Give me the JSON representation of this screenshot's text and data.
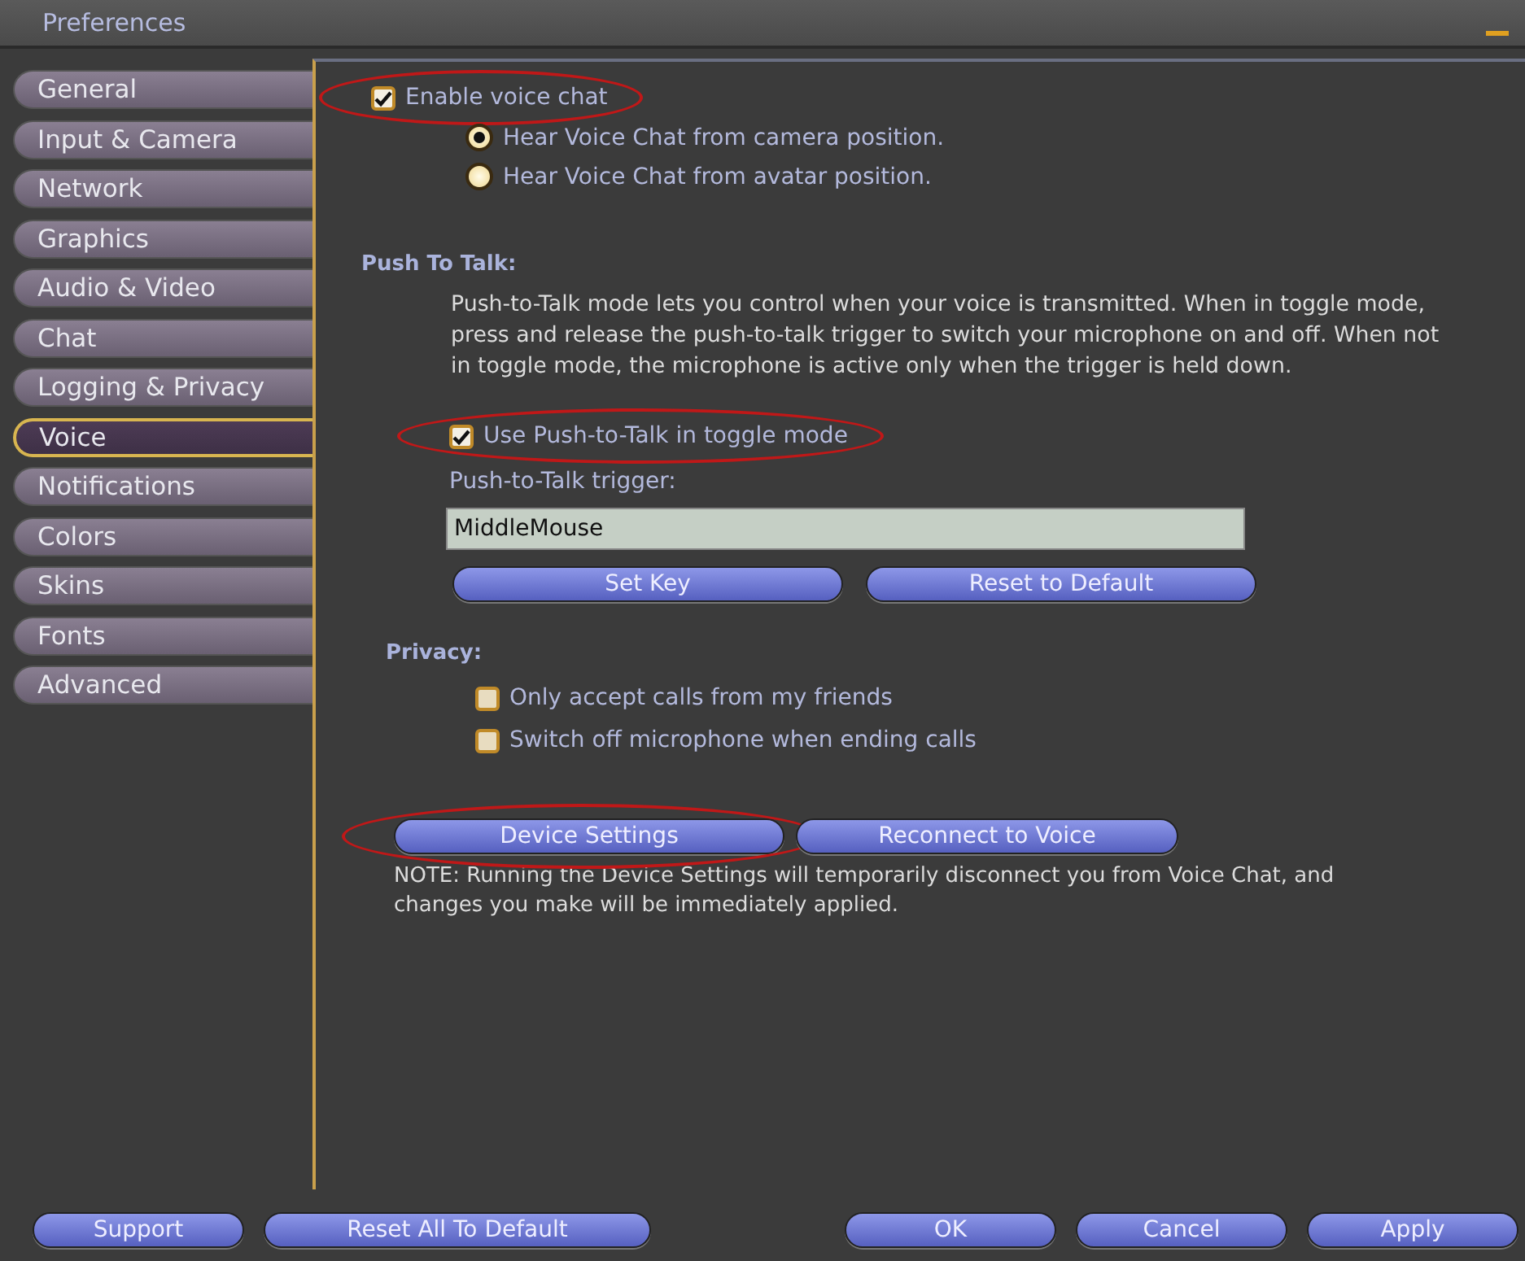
{
  "window": {
    "title": "Preferences"
  },
  "sidebar": {
    "items": [
      {
        "label": "General",
        "selected": false
      },
      {
        "label": "Input & Camera",
        "selected": false
      },
      {
        "label": "Network",
        "selected": false
      },
      {
        "label": "Graphics",
        "selected": false
      },
      {
        "label": "Audio & Video",
        "selected": false
      },
      {
        "label": "Chat",
        "selected": false
      },
      {
        "label": "Logging & Privacy",
        "selected": false
      },
      {
        "label": "Voice",
        "selected": true
      },
      {
        "label": "Notifications",
        "selected": false
      },
      {
        "label": "Colors",
        "selected": false
      },
      {
        "label": "Skins",
        "selected": false
      },
      {
        "label": "Fonts",
        "selected": false
      },
      {
        "label": "Advanced",
        "selected": false
      }
    ]
  },
  "voice": {
    "enable": {
      "label": "Enable voice chat",
      "checked": true,
      "highlighted": true
    },
    "hear_options": [
      {
        "label": "Hear Voice Chat from camera position.",
        "selected": true
      },
      {
        "label": "Hear Voice Chat from avatar position.",
        "selected": false
      }
    ],
    "push_to_talk": {
      "heading": "Push To Talk:",
      "description": "Push-to-Talk mode lets you control when your voice is transmitted. When in toggle mode, press and release the push-to-talk trigger to switch your microphone on and off. When not in toggle mode, the microphone is active only when the trigger is held down.",
      "toggle": {
        "label": "Use Push-to-Talk in toggle mode",
        "checked": true,
        "highlighted": true
      },
      "trigger_label": "Push-to-Talk trigger:",
      "trigger_value": "MiddleMouse",
      "buttons": [
        {
          "label": "Set Key",
          "highlighted": false
        },
        {
          "label": "Reset to Default",
          "highlighted": false
        }
      ]
    },
    "privacy": {
      "heading": "Privacy:",
      "options": [
        {
          "label": "Only accept calls from my friends",
          "checked": false
        },
        {
          "label": "Switch off microphone when ending calls",
          "checked": false
        }
      ]
    },
    "buttons": [
      {
        "label": "Device Settings",
        "highlighted": true
      },
      {
        "label": "Reconnect to Voice",
        "highlighted": false
      }
    ],
    "note": "NOTE: Running the Device Settings will temporarily disconnect you from Voice Chat, and changes you make will be immediately applied."
  },
  "footer": {
    "left_buttons": [
      "Support",
      "Reset All To Default"
    ],
    "right_buttons": [
      "OK",
      "Cancel",
      "Apply"
    ]
  }
}
